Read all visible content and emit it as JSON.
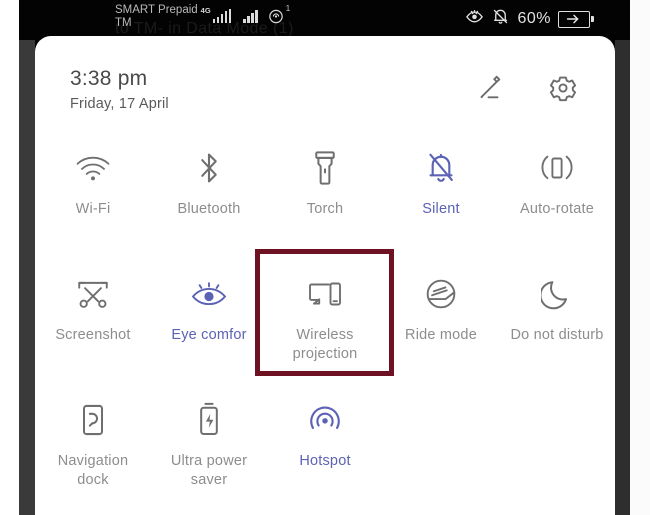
{
  "status_bar": {
    "carrier_line1": "SMART Prepaid",
    "carrier_line2": "TM",
    "network_type": "4G",
    "sim2_superscript": "1",
    "ghost_text": "to TM- in Data Mode (1)",
    "battery_percent": "60%",
    "icons": {
      "eye_off": "eye-off-icon",
      "bell_off": "bell-off-icon",
      "signal_primary": "signal-bars-icon",
      "signal_secondary": "signal-bars-icon",
      "hotspot_status": "hotspot-icon",
      "battery": "battery-charging-icon"
    }
  },
  "panel": {
    "time": "3:38 pm",
    "date": "Friday, 17 April",
    "edit_icon": "pencil-edit-icon",
    "settings_icon": "gear-settings-icon"
  },
  "colors": {
    "active": "#5c62b5",
    "inactive": "#8d8d8d",
    "icon_inactive": "#6f6f6f",
    "highlight_border": "#6d1123",
    "panel_bg": "#ffffff",
    "status_bg": "#030303"
  },
  "highlight": {
    "target": "Wireless projection",
    "border_color": "#6d1123"
  },
  "tiles": [
    {
      "id": "wifi",
      "label": "Wi-Fi",
      "icon": "wifi-icon",
      "active": false
    },
    {
      "id": "bluetooth",
      "label": "Bluetooth",
      "icon": "bluetooth-icon",
      "active": false
    },
    {
      "id": "torch",
      "label": "Torch",
      "icon": "flashlight-icon",
      "active": false
    },
    {
      "id": "silent",
      "label": "Silent",
      "icon": "bell-off-icon",
      "active": true
    },
    {
      "id": "auto-rotate",
      "label": "Auto-rotate",
      "icon": "auto-rotate-icon",
      "active": false
    },
    {
      "id": "screenshot",
      "label": "Screenshot",
      "icon": "screenshot-scissors-icon",
      "active": false
    },
    {
      "id": "eye-comfort",
      "label": "Eye comfor",
      "icon": "eye-comfort-icon",
      "active": true
    },
    {
      "id": "wireless-projection",
      "label": "Wireless projection",
      "icon": "cast-screen-icon",
      "active": false
    },
    {
      "id": "ride-mode",
      "label": "Ride mode",
      "icon": "helmet-icon",
      "active": false
    },
    {
      "id": "do-not-disturb",
      "label": "Do not disturb",
      "icon": "moon-icon",
      "active": false
    },
    {
      "id": "navigation-dock",
      "label": "Navigation dock",
      "icon": "navigation-dock-icon",
      "active": false
    },
    {
      "id": "ultra-power-saver",
      "label": "Ultra power saver",
      "icon": "battery-bolt-icon",
      "active": false
    },
    {
      "id": "hotspot",
      "label": "Hotspot",
      "icon": "hotspot-icon",
      "active": true
    }
  ]
}
